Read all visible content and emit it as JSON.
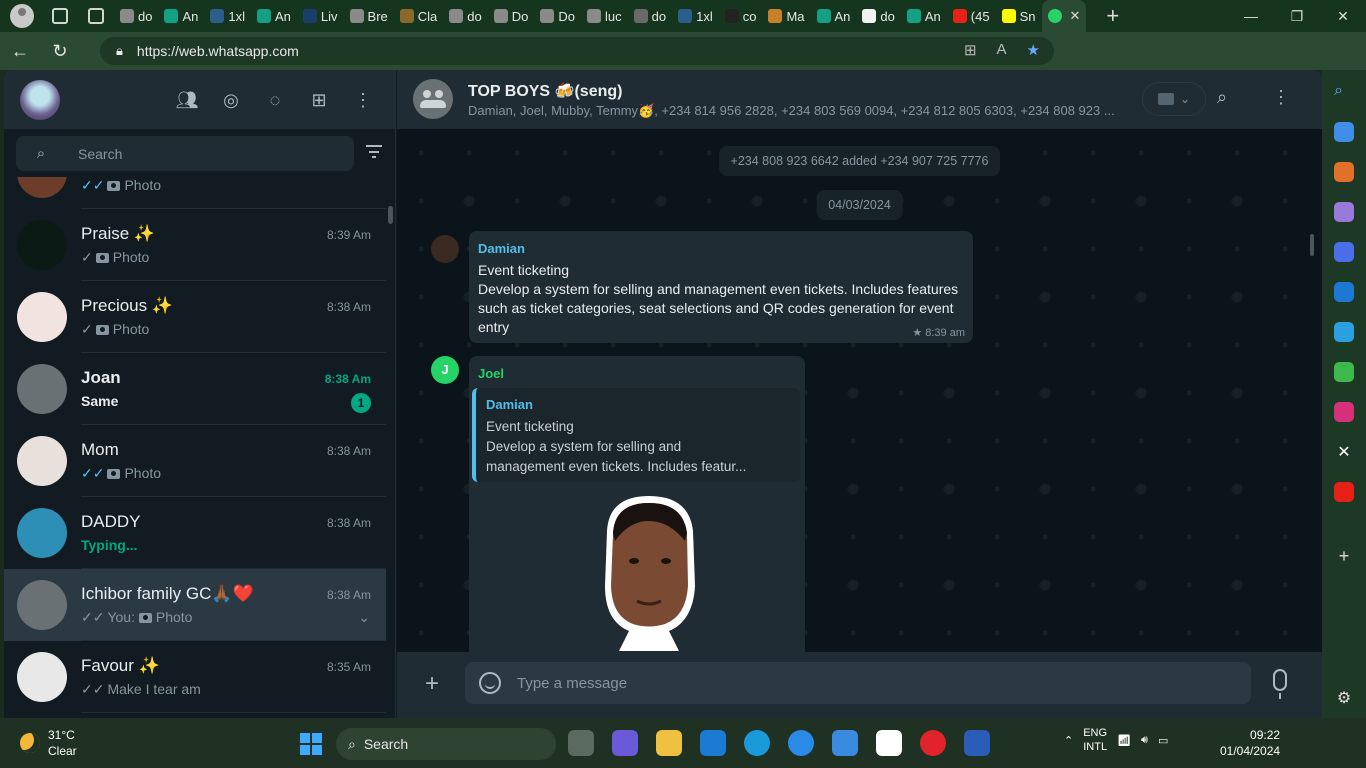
{
  "browser": {
    "tabs": [
      {
        "label": "do",
        "color": "#8a8a8a"
      },
      {
        "label": "An",
        "color": "#14a085"
      },
      {
        "label": "1xl",
        "color": "#2b5f8a"
      },
      {
        "label": "An",
        "color": "#14a085"
      },
      {
        "label": "Liv",
        "color": "#1a3e6b"
      },
      {
        "label": "Bre",
        "color": "#8a8a8a"
      },
      {
        "label": "Cla",
        "color": "#8a6a2a"
      },
      {
        "label": "do",
        "color": "#8a8a8a"
      },
      {
        "label": "Do",
        "color": "#8a8a8a"
      },
      {
        "label": "Do",
        "color": "#8a8a8a"
      },
      {
        "label": "luc",
        "color": "#8a8a8a"
      },
      {
        "label": "do",
        "color": "#6a6a6a"
      },
      {
        "label": "1xl",
        "color": "#2b5f8a"
      },
      {
        "label": "co",
        "color": "#222222"
      },
      {
        "label": "Ma",
        "color": "#c8802a"
      },
      {
        "label": "An",
        "color": "#14a085"
      },
      {
        "label": "do",
        "color": "#f2f2f2"
      },
      {
        "label": "An",
        "color": "#14a085"
      },
      {
        "label": "(45",
        "color": "#e62117"
      },
      {
        "label": "Sn",
        "color": "#fffc00"
      }
    ],
    "active_tab": {
      "label": "",
      "color": "#25d366"
    },
    "url": "https://web.whatsapp.com"
  },
  "sidebar": {
    "search_placeholder": "Search",
    "partial_top": {
      "preview": "Photo"
    },
    "chats": [
      {
        "name": "Praise ✨",
        "time": "8:39 Am",
        "preview": "Photo",
        "tick": "✓",
        "tick_blue": false,
        "photo": true,
        "avatar": "#0b1a14"
      },
      {
        "name": "Precious ✨",
        "time": "8:38 Am",
        "preview": "Photo",
        "tick": "✓",
        "tick_blue": false,
        "photo": true,
        "avatar": "#f1e4e0"
      },
      {
        "name": "Joan",
        "time": "8:38 Am",
        "preview": "Same",
        "unread": "1",
        "avatar": "#6a7175"
      },
      {
        "name": "Mom",
        "time": "8:38 Am",
        "preview": "Photo",
        "tick": "✓✓",
        "tick_blue": true,
        "photo": true,
        "avatar": "#e8e0da"
      },
      {
        "name": "DADDY",
        "time": "8:38 Am",
        "preview": "Typing...",
        "avatar": "#2d8fb5"
      },
      {
        "name": "Ichibor family GC🙏🏾❤️",
        "time": "8:38 Am",
        "preview_prefix": "You: ",
        "preview": "Photo",
        "tick": "✓✓",
        "tick_blue": false,
        "photo": true,
        "avatar": "#6a7175"
      },
      {
        "name": "Favour ✨",
        "time": "8:35 Am",
        "preview": "Make I tear am",
        "tick": "✓✓",
        "tick_blue": false,
        "avatar": "#e8e8e8"
      }
    ]
  },
  "conversation": {
    "title": "TOP BOYS 🍻(seng)",
    "members": "Damian, Joel, Mubby, Temmy🥳, +234 814 956 2828, +234 803 569 0094, +234 812 805 6303, +234 808 923 ...",
    "system_message": "+234 808 923 6642 added +234 907 725 7776",
    "date_divider": "04/03/2024",
    "message1": {
      "sender": "Damian",
      "sender_color": "#53bdeb",
      "line1": "Event ticketing",
      "line2": "Develop a system for selling and management even tickets. Includes features such as ticket categories, seat selections and QR codes generation for event entry",
      "time": "8:39 am"
    },
    "message2": {
      "sender": "Joel",
      "avatar_letter": "J",
      "sender_color": "#25d366",
      "quote_sender": "Damian",
      "quote_line1": "Event ticketing",
      "quote_line2": "Develop a system for selling and management even tickets. Includes featur..."
    },
    "composer_placeholder": "Type a message"
  },
  "taskbar": {
    "temp": "31°C",
    "condition": "Clear",
    "search_label": "Search",
    "lang1": "ENG",
    "lang2": "INTL",
    "time": "09:22",
    "date": "01/04/2024"
  },
  "colors": {
    "accent": "#00a884",
    "link_blue": "#53bdeb",
    "panel": "#202c33",
    "background": "#111b21"
  }
}
